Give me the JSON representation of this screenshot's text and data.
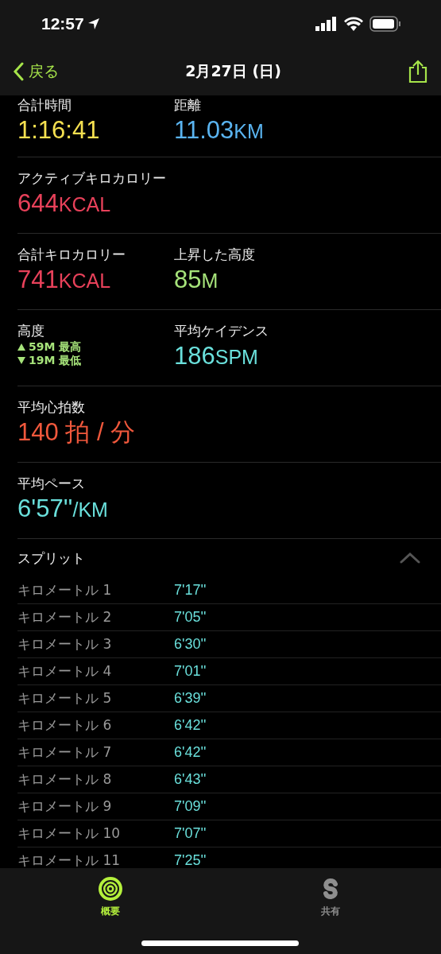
{
  "status_bar": {
    "time": "12:57"
  },
  "nav": {
    "back": "戻る",
    "title": "2月27日 (日)"
  },
  "metric_rows": [
    {
      "cells": [
        {
          "kind": "value",
          "label": "合計時間",
          "value": "1:16:41",
          "color": "#f5e050"
        },
        {
          "kind": "value",
          "label": "距離",
          "value": "11.03",
          "unit": "KM",
          "color": "#5ab4f0"
        }
      ]
    },
    {
      "cells": [
        {
          "kind": "value",
          "label": "アクティブキロカロリー",
          "value": "644",
          "unit": "KCAL",
          "color": "#e8415a"
        }
      ]
    },
    {
      "cells": [
        {
          "kind": "value",
          "label": "合計キロカロリー",
          "value": "741",
          "unit": "KCAL",
          "color": "#e8415a"
        },
        {
          "kind": "value",
          "label": "上昇した高度",
          "value": "85",
          "unit": "M",
          "color": "#a6e37a"
        }
      ]
    },
    {
      "cells": [
        {
          "kind": "range",
          "label": "高度",
          "high": "59M 最高",
          "low": "19M 最低",
          "color": "#a6e37a"
        },
        {
          "kind": "value",
          "label": "平均ケイデンス",
          "value": "186",
          "unit": "SPM",
          "color": "#6ae0dc"
        }
      ]
    },
    {
      "cells": [
        {
          "kind": "value",
          "label": "平均心拍数",
          "value": "140 拍 / 分",
          "color": "#f0583c"
        }
      ]
    },
    {
      "cells": [
        {
          "kind": "value",
          "label": "平均ペース",
          "value": "6'57''",
          "unit": "/KM",
          "color": "#6ae0dc"
        }
      ]
    }
  ],
  "splits": {
    "title": "スプリット",
    "expanded": true,
    "rows": [
      {
        "label": "キロメートル 1",
        "pace": "7'17''"
      },
      {
        "label": "キロメートル 2",
        "pace": "7'05''"
      },
      {
        "label": "キロメートル 3",
        "pace": "6'30''"
      },
      {
        "label": "キロメートル 4",
        "pace": "7'01''"
      },
      {
        "label": "キロメートル 5",
        "pace": "6'39''"
      },
      {
        "label": "キロメートル 6",
        "pace": "6'42''"
      },
      {
        "label": "キロメートル 7",
        "pace": "6'42''"
      },
      {
        "label": "キロメートル 8",
        "pace": "6'43''"
      },
      {
        "label": "キロメートル 9",
        "pace": "7'09''"
      },
      {
        "label": "キロメートル 10",
        "pace": "7'07''"
      },
      {
        "label": "キロメートル 11",
        "pace": "7'25''"
      }
    ]
  },
  "tabs": [
    {
      "kind": "summary",
      "label": "概要",
      "selected": true
    },
    {
      "kind": "sharing",
      "label": "共有",
      "selected": false
    }
  ]
}
